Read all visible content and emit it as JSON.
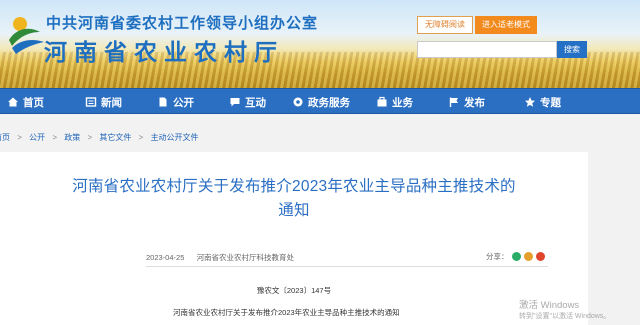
{
  "header": {
    "org_line": "中共河南省委农村工作领导小组办公室",
    "title": "河南省农业农村厅",
    "accessibility_label": "无障碍阅读",
    "elder_mode_label": "进入适老模式",
    "search_placeholder": "",
    "search_button": "搜索"
  },
  "nav": {
    "items": [
      {
        "label": "首页",
        "icon": "home-icon"
      },
      {
        "label": "新闻",
        "icon": "news-icon"
      },
      {
        "label": "公开",
        "icon": "doc-icon"
      },
      {
        "label": "互动",
        "icon": "chat-icon"
      },
      {
        "label": "政务服务",
        "icon": "service-icon"
      },
      {
        "label": "业务",
        "icon": "briefcase-icon"
      },
      {
        "label": "发布",
        "icon": "flag-icon"
      },
      {
        "label": "专题",
        "icon": "topic-icon"
      }
    ]
  },
  "breadcrumb": [
    "首页",
    "公开",
    "政策",
    "其它文件",
    "主动公开文件"
  ],
  "article": {
    "title_line1": "河南省农业农村厅关于发布推介2023年农业主导品种主推技术的",
    "title_line2": "通知",
    "date": "2023-04-25",
    "source": "河南省农业农村厅科技教育处",
    "share_label": "分享：",
    "doc_number": "豫农文〔2023〕147号",
    "body_first_line": "河南省农业农村厅关于发布推介2023年农业主导品种主推技术的通知"
  },
  "watermark": {
    "line1": "激活 Windows",
    "line2": "转到\"设置\"以激活 Windows。"
  },
  "colors": {
    "nav_bg": "#2b6fc3",
    "title_blue": "#2b6fc3",
    "elder_btn": "#f28a1e",
    "search_btn": "#2470c4"
  }
}
